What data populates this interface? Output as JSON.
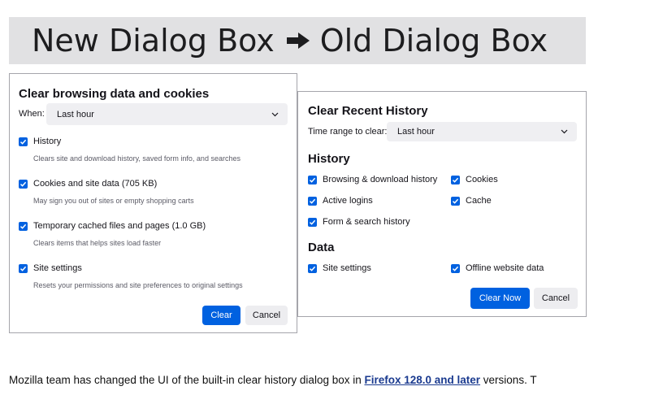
{
  "banner": {
    "left_text": "New Dialog Box",
    "right_text": "Old Dialog Box",
    "arrow_icon": "right-arrow-icon"
  },
  "new_dialog": {
    "title": "Clear browsing data and cookies",
    "when_label": "When:",
    "when_value": "Last hour",
    "items": [
      {
        "label": "History",
        "description": "Clears site and download history, saved form info, and searches",
        "checked": true
      },
      {
        "label": "Cookies and site data (705 KB)",
        "description": "May sign you out of sites or empty shopping carts",
        "checked": true
      },
      {
        "label": "Temporary cached files and pages (1.0 GB)",
        "description": "Clears items that helps sites load faster",
        "checked": true
      },
      {
        "label": "Site settings",
        "description": "Resets your permissions and site preferences to original settings",
        "checked": true
      }
    ],
    "clear_button": "Clear",
    "cancel_button": "Cancel"
  },
  "old_dialog": {
    "title": "Clear Recent History",
    "range_label": "Time range to clear:",
    "range_value": "Last hour",
    "history_heading": "History",
    "history_items": [
      {
        "label": "Browsing & download history",
        "checked": true
      },
      {
        "label": "Cookies",
        "checked": true
      },
      {
        "label": "Active logins",
        "checked": true
      },
      {
        "label": "Cache",
        "checked": true
      },
      {
        "label": "Form & search history",
        "checked": true
      }
    ],
    "data_heading": "Data",
    "data_items": [
      {
        "label": "Site settings",
        "checked": true
      },
      {
        "label": "Offline website data",
        "checked": true
      }
    ],
    "clear_now_button": "Clear Now",
    "cancel_button": "Cancel"
  },
  "caption": {
    "before": "Mozilla team has changed the UI of the built-in clear history dialog box in ",
    "link": "Firefox 128.0 and later",
    "after": " versions. T"
  },
  "colors": {
    "accent": "#0061e0",
    "banner_bg": "#e1e1e3",
    "link": "#1a3a8f"
  }
}
